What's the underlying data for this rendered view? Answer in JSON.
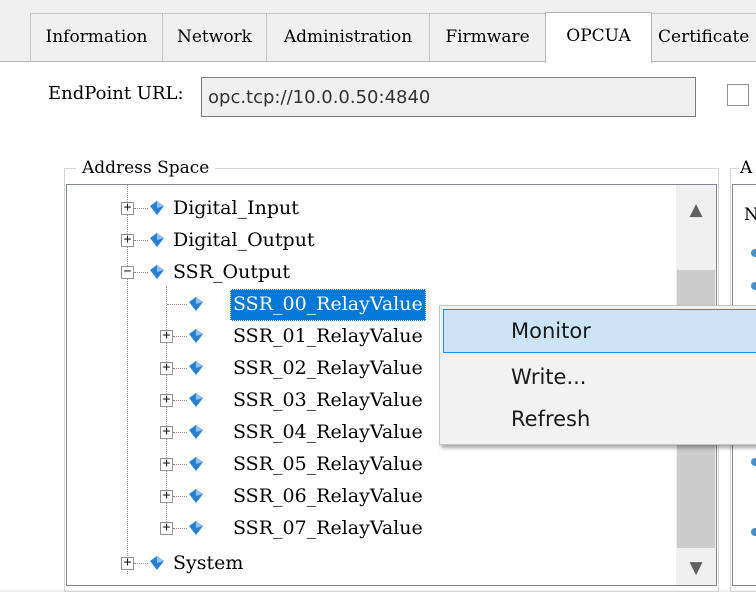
{
  "tabs": [
    {
      "label": "Information",
      "selected": false
    },
    {
      "label": "Network",
      "selected": false
    },
    {
      "label": "Administration",
      "selected": false
    },
    {
      "label": "Firmware",
      "selected": false
    },
    {
      "label": "OPCUA",
      "selected": true
    },
    {
      "label": "Certificate",
      "selected": false
    }
  ],
  "endpoint": {
    "label": "EndPoint URL:",
    "value": "opc.tcp://10.0.0.50:4840",
    "checked": false
  },
  "address_space": {
    "legend": "Address Space",
    "tree": [
      {
        "label": "Digital_Input",
        "expander": "+"
      },
      {
        "label": "Digital_Output",
        "expander": "+"
      },
      {
        "label": "SSR_Output",
        "expander": "−"
      },
      {
        "label": "SSR_00_RelayValue",
        "expander": "",
        "selected": true
      },
      {
        "label": "SSR_01_RelayValue",
        "expander": "+"
      },
      {
        "label": "SSR_02_RelayValue",
        "expander": "+"
      },
      {
        "label": "SSR_03_RelayValue",
        "expander": "+"
      },
      {
        "label": "SSR_04_RelayValue",
        "expander": "+"
      },
      {
        "label": "SSR_05_RelayValue",
        "expander": "+"
      },
      {
        "label": "SSR_06_RelayValue",
        "expander": "+"
      },
      {
        "label": "SSR_07_RelayValue",
        "expander": "+"
      },
      {
        "label": "System",
        "expander": "+"
      }
    ],
    "scroll_up_icon": "▲",
    "scroll_down_icon": "▼",
    "node_icon": "blue-diamond-icon"
  },
  "right_panel": {
    "legend": "A",
    "header": "N"
  },
  "context_menu": {
    "items": [
      {
        "label": "Monitor",
        "highlighted": true
      },
      {
        "label": "Write...",
        "highlighted": false
      },
      {
        "label": "Refresh",
        "highlighted": false
      }
    ]
  },
  "colors": {
    "selection": "#0078d7",
    "menu_highlight": "#cce4f7",
    "node_icon": "#2d7fd3"
  }
}
